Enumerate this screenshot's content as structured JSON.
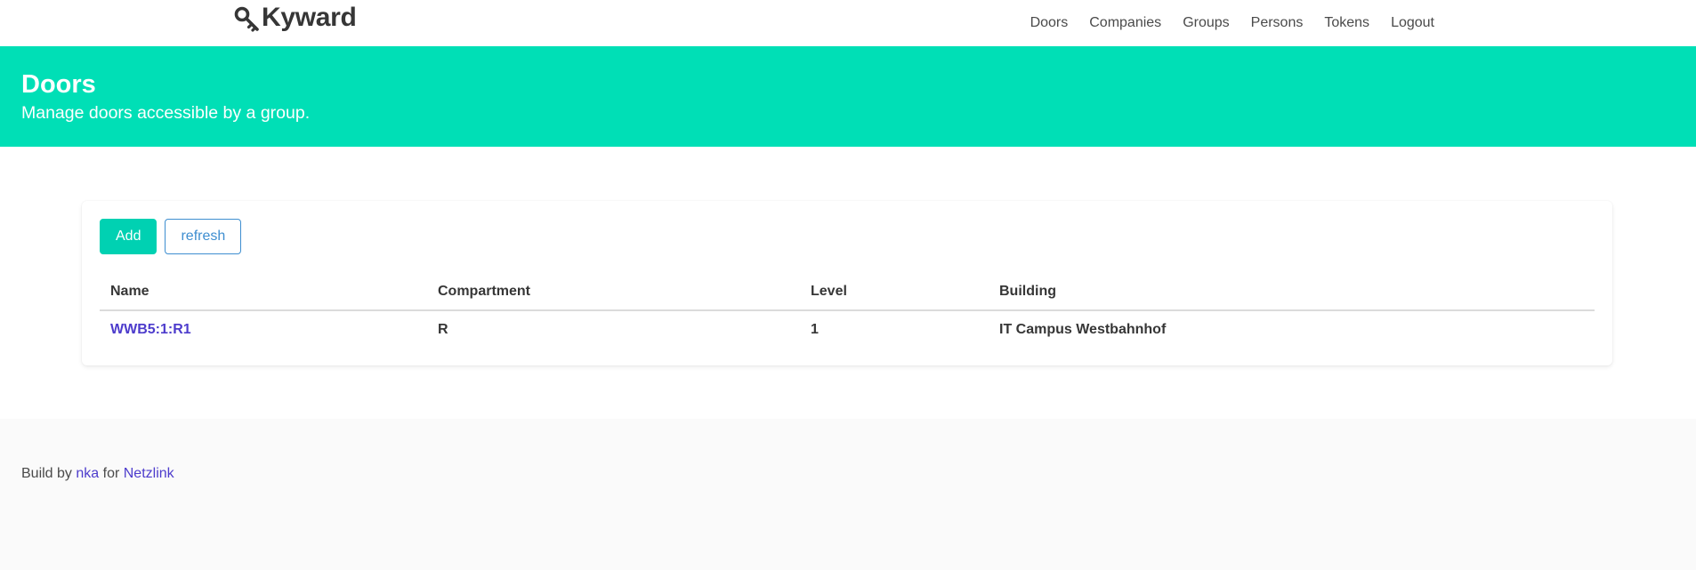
{
  "navbar": {
    "brand": "Kyward",
    "brand_icon": "key-icon",
    "menu": [
      "Doors",
      "Companies",
      "Groups",
      "Persons",
      "Tokens",
      "Logout"
    ]
  },
  "hero": {
    "title": "Doors",
    "subtitle": "Manage doors accessible by a group.",
    "background": "#00dfb6"
  },
  "toolbar": {
    "add_label": "Add",
    "refresh_label": "refresh"
  },
  "table": {
    "columns": [
      "Name",
      "Compartment",
      "Level",
      "Building"
    ],
    "rows": [
      {
        "name": "WWB5:1:R1",
        "compartment": "R",
        "level": "1",
        "building": "IT Campus Westbahnhof"
      }
    ]
  },
  "footer": {
    "prefix": "Build by",
    "author": "nka",
    "middle": "for",
    "org": "Netzlink"
  },
  "colors": {
    "primary": "#00d1b2",
    "link": "#4d3ccc",
    "info": "#3e8ed0"
  }
}
